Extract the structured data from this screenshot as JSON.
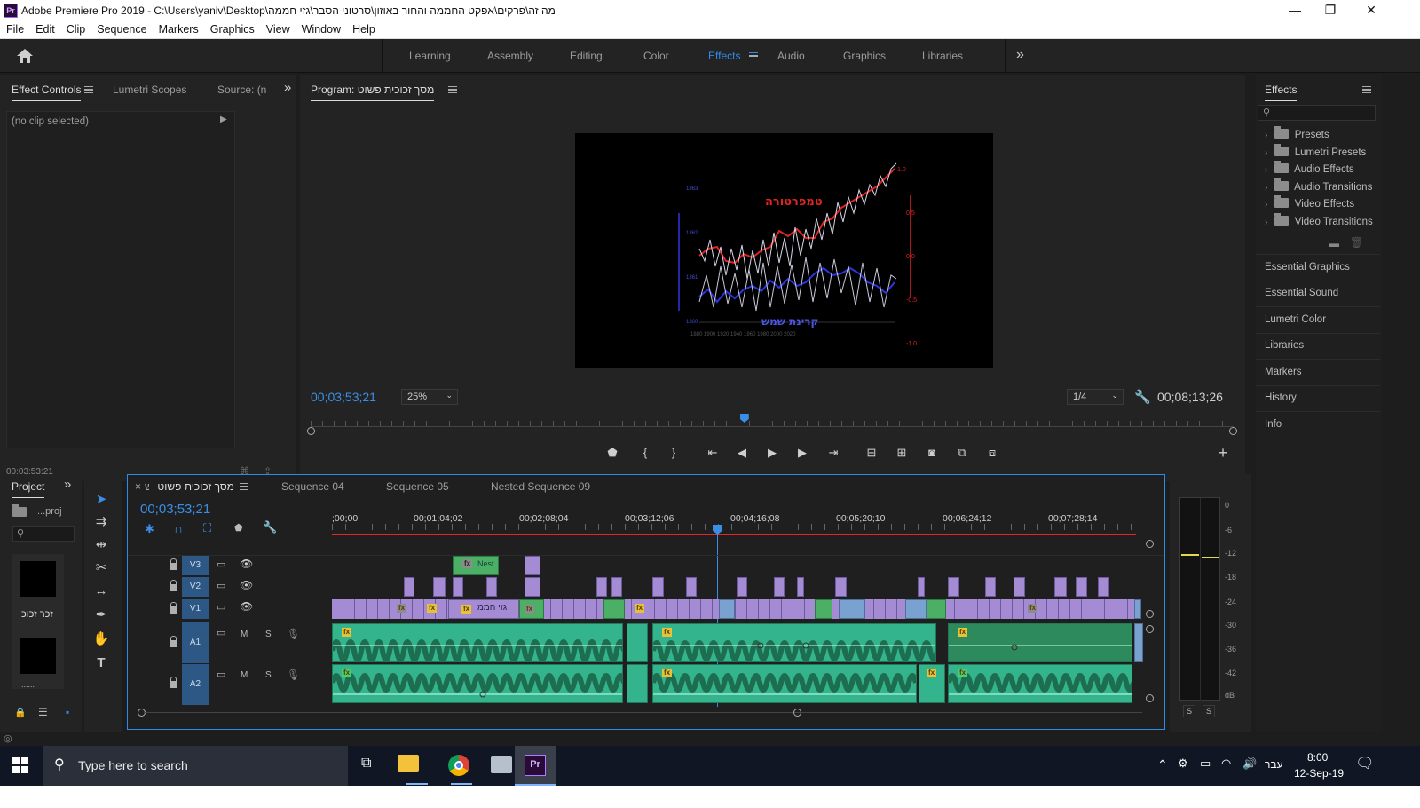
{
  "window": {
    "title": "Adobe Premiere Pro 2019 - C:\\Users\\yaniv\\Desktop\\מה זה\\פרקים\\אפקט החממה והחור באוזון\\סרטוני הסבר\\גזי חממה",
    "app_icon": "Pr",
    "minimize": "—",
    "restore": "❐",
    "close": "✕"
  },
  "menu": [
    "File",
    "Edit",
    "Clip",
    "Sequence",
    "Markers",
    "Graphics",
    "View",
    "Window",
    "Help"
  ],
  "workspaces": {
    "items": [
      "Learning",
      "Assembly",
      "Editing",
      "Color",
      "Effects",
      "Audio",
      "Graphics",
      "Libraries"
    ],
    "active": "Effects",
    "more": "»"
  },
  "effect_controls": {
    "tabs": [
      "Effect Controls",
      "Lumetri Scopes",
      "Source: (n"
    ],
    "more": "»",
    "no_clip": "(no clip selected)",
    "timecode": "00;03;53;21"
  },
  "program": {
    "title": "Program: מסך זכוכית פשוט",
    "timecode": "00;03;53;21",
    "zoom": "25%",
    "resolution": "1/4",
    "duration": "00;08;13;26",
    "playhead_fraction": 0.47,
    "video_labels": {
      "temp": "טמפרטורה",
      "sun": "קרינת שמש"
    }
  },
  "effects_panel": {
    "title": "Effects",
    "items": [
      "Presets",
      "Lumetri Presets",
      "Audio Effects",
      "Audio Transitions",
      "Video Effects",
      "Video Transitions"
    ],
    "side": [
      "Essential Graphics",
      "Essential Sound",
      "Lumetri Color",
      "Libraries",
      "Markers",
      "History",
      "Info"
    ]
  },
  "project": {
    "tab": "Project",
    "more": "»",
    "file": "...proj",
    "thumb1_label": "זכר זכוכ",
    "thumb2_label": "......"
  },
  "timeline": {
    "tabs": [
      "מסך זכוכית פשוט",
      "Sequence 04",
      "Sequence 05",
      "Nested Sequence 09"
    ],
    "close": "×",
    "timecode": "00;03;53;21",
    "ruler": [
      ";00;00",
      "00;01;04;02",
      "00;02;08;04",
      "00;03;12;06",
      "00;04;16;08",
      "00;05;20;10",
      "00;06;24;12",
      "00;07;28;14"
    ],
    "tracks": [
      "V3",
      "V2",
      "V1",
      "A1",
      "A2"
    ],
    "m": "M",
    "s": "S",
    "nest_label": "Nest",
    "clip_label": "גזי חממ",
    "fx": "fx"
  },
  "meter": {
    "labels": [
      "0",
      "-6",
      "-12",
      "-18",
      "-24",
      "-30",
      "-36",
      "-42",
      "dB"
    ],
    "solo": [
      "S",
      "S"
    ]
  },
  "taskbar": {
    "search_placeholder": "Type here to search",
    "lang": "עבר",
    "time": "8:00",
    "date": "12-Sep-19"
  }
}
